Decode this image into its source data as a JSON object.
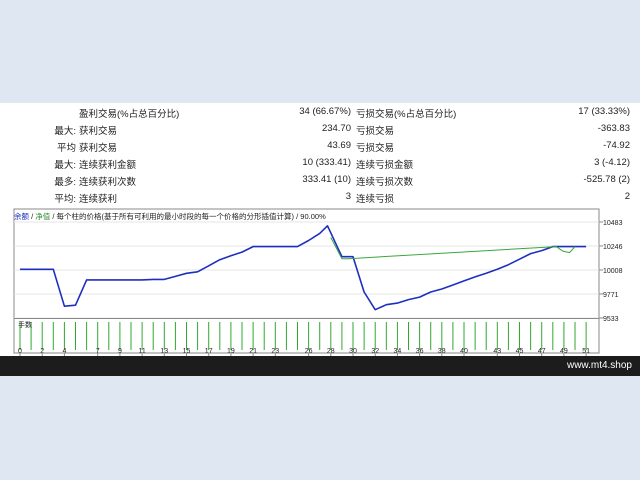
{
  "stats_rows": [
    {
      "label": "",
      "name1": "盈利交易(%占总百分比)",
      "value1": "34 (66.67%)",
      "name2": "亏损交易(%占总百分比)",
      "value2": "17 (33.33%)"
    },
    {
      "label": "最大:",
      "name1": "获利交易",
      "value1": "234.70",
      "name2": "亏损交易",
      "value2": "-363.83"
    },
    {
      "label": "平均",
      "name1": "获利交易",
      "value1": "43.69",
      "name2": "亏损交易",
      "value2": "-74.92"
    },
    {
      "label": "最大:",
      "name1": "连续获利金额",
      "value1": "10 (333.41)",
      "name2": "连续亏损金额",
      "value2": "3 (-4.12)"
    },
    {
      "label": "最多:",
      "name1": "连续获利次数",
      "value1": "333.41 (10)",
      "name2": "连续亏损次数",
      "value2": "-525.78 (2)"
    },
    {
      "label": "平均:",
      "name1": "连续获利",
      "value1": "3",
      "name2": "连续亏损",
      "value2": "2"
    }
  ],
  "chart_header": {
    "balance": "余额",
    "equity": "净值",
    "desc": "每个柱的价格(基于所有可利用的最小时段的每一个价格的分形插值计算)",
    "quality": "90.00%"
  },
  "lots_label": "手数",
  "chart_data": {
    "type": "line",
    "x_ticks": [
      0,
      2,
      4,
      7,
      9,
      11,
      13,
      15,
      17,
      19,
      21,
      23,
      26,
      28,
      30,
      32,
      34,
      36,
      38,
      40,
      43,
      45,
      47,
      49,
      51
    ],
    "y_ticks": [
      9533,
      9771,
      10008,
      10246,
      10483
    ],
    "xlim": [
      0,
      51.8
    ],
    "ylim": [
      9533,
      10483
    ],
    "series": [
      {
        "x": [
          0,
          3.0,
          4,
          5,
          6,
          7,
          8,
          9,
          10,
          11,
          12,
          13,
          14,
          15,
          16,
          17,
          18,
          19,
          20,
          21,
          22,
          23,
          24,
          25,
          26,
          27,
          27.7,
          29,
          30,
          31,
          32,
          33,
          34,
          35,
          36,
          37,
          38,
          39,
          40,
          41,
          42,
          43,
          44,
          45,
          46,
          47,
          48,
          49,
          50,
          51
        ],
        "values": [
          10015,
          10015,
          9650,
          9660,
          9910,
          9910,
          9910,
          9910,
          9910,
          9910,
          9915,
          9915,
          9945,
          9975,
          9990,
          10050,
          10110,
          10150,
          10185,
          10240,
          10240,
          10240,
          10240,
          10240,
          10300,
          10370,
          10445,
          10140,
          10140,
          9790,
          9615,
          9665,
          9680,
          9715,
          9740,
          9790,
          9820,
          9860,
          9900,
          9940,
          9975,
          10015,
          10060,
          10115,
          10170,
          10200,
          10240,
          10240,
          10240,
          10240
        ]
      },
      {
        "x": [
          28,
          29,
          29.6,
          48.3,
          48.9,
          49.5,
          50
        ],
        "values": [
          10330,
          10120,
          10120,
          10240,
          10195,
          10180,
          10240
        ]
      }
    ],
    "lots": 1.0
  }
}
